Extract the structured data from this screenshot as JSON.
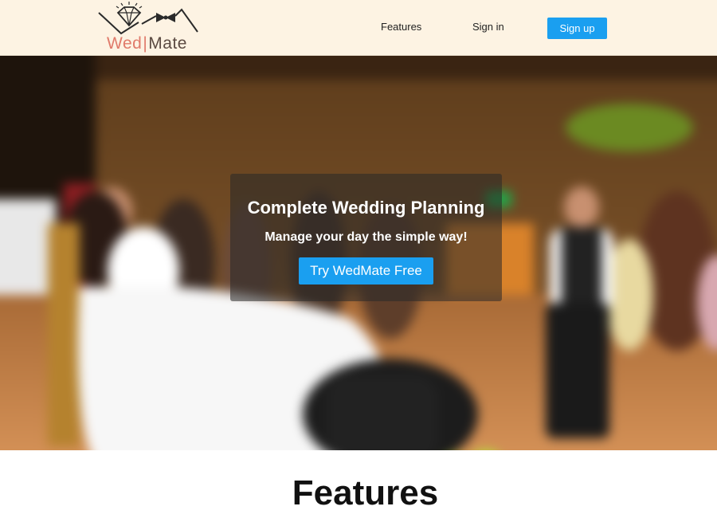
{
  "brand": {
    "name_part1": "Wed",
    "separator": "|",
    "name_part2": "Mate",
    "icons": [
      "diamond-icon",
      "bow-tie-icon"
    ],
    "color_primary": "#e07a6a",
    "color_secondary": "#5a4a42"
  },
  "nav": {
    "features_label": "Features",
    "signin_label": "Sign in",
    "signup_label": "Sign up",
    "background": "#fdf3e3",
    "accent": "#1a9ff0"
  },
  "hero": {
    "title": "Complete Wedding Planning",
    "subtitle": "Manage your day the simple way!",
    "cta_label": "Try WedMate Free",
    "image": "blurred-wedding-photo"
  },
  "features": {
    "heading": "Features"
  }
}
